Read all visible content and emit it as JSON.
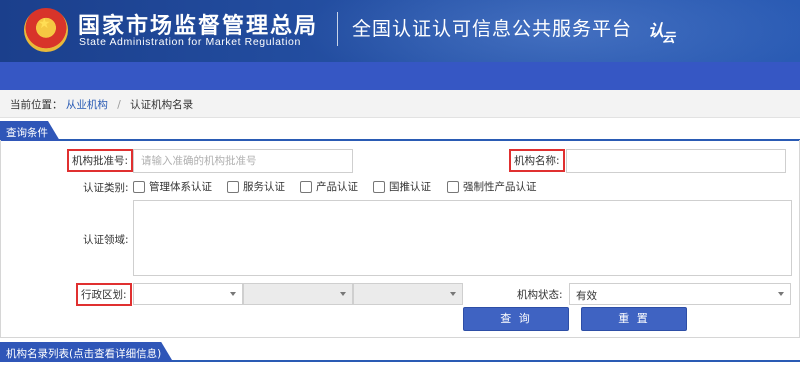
{
  "header": {
    "agency_cn": "国家市场监督管理总局",
    "agency_en": "State Administration  for  Market Regulation",
    "platform": "全国认证认可信息公共服务平台",
    "logo_text_a": "认",
    "logo_text_b": "云"
  },
  "breadcrumb": {
    "current_label": "当前位置：",
    "items": [
      "从业机构",
      "认证机构名录"
    ]
  },
  "query": {
    "section_title": "查询条件",
    "approval_no_label": "机构批准号:",
    "approval_no_placeholder": "请输入准确的机构批准号",
    "approval_no_value": "",
    "name_label": "机构名称:",
    "name_value": "",
    "cert_type_label": "认证类别:",
    "cert_types": [
      "管理体系认证",
      "服务认证",
      "产品认证",
      "国推认证",
      "强制性产品认证"
    ],
    "cert_field_label": "认证领域:",
    "region_label": "行政区划:",
    "region_values": [
      "",
      "",
      ""
    ],
    "status_label": "机构状态:",
    "status_value": "有效",
    "search_button": "查 询",
    "reset_button": "重 置"
  },
  "list": {
    "section_title": "机构名录列表(点击查看详细信息)"
  },
  "colors": {
    "header_blue": "#2653a8",
    "nav_blue": "#3657c4",
    "tab_blue": "#2f56b8",
    "highlight_red": "#e03030",
    "link_blue": "#2a5bb4"
  }
}
